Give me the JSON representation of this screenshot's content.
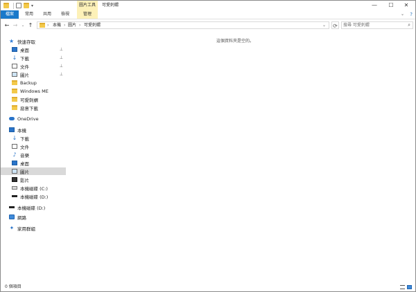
{
  "title_bar": {
    "contextual_tab": "圖片工具",
    "window_title": "可愛刺蝟",
    "minimize": "—",
    "maximize": "☐",
    "close": "✕",
    "qa_dropdown": "▾"
  },
  "ribbon": {
    "tabs": [
      "檔案",
      "常用",
      "共用",
      "檢視",
      "管理"
    ],
    "expand": "⌄",
    "help": "?"
  },
  "address_bar": {
    "back": "←",
    "forward": "→",
    "recent": "⌄",
    "up": "↑",
    "crumb_sep": "›",
    "crumbs": [
      "本機",
      "圖片",
      "可愛刺蝟"
    ],
    "dropdown": "⌄",
    "refresh": "⟳",
    "search_placeholder": "搜尋 可愛刺蝟",
    "search_icon": "⌕"
  },
  "sidebar": {
    "quick_access": "快速存取",
    "quick_items": [
      "桌面",
      "下載",
      "文件",
      "圖片",
      "Backup",
      "Windows ME",
      "可愛刺蝟",
      "惡意下載"
    ],
    "onedrive": "OneDrive",
    "this_pc": "本機",
    "pc_items": [
      "下載",
      "文件",
      "音樂",
      "桌面",
      "圖片",
      "影片",
      "本機磁碟 (C:)",
      "本機磁碟 (D:)"
    ],
    "dvd": "本機磁碟 (D:)",
    "network": "網路",
    "homegroup": "家用群組",
    "selected": "圖片",
    "pin_glyph": "📌"
  },
  "content": {
    "empty_message": "這個資料夾是空的。"
  },
  "status_bar": {
    "item_count": "0 個項目"
  }
}
